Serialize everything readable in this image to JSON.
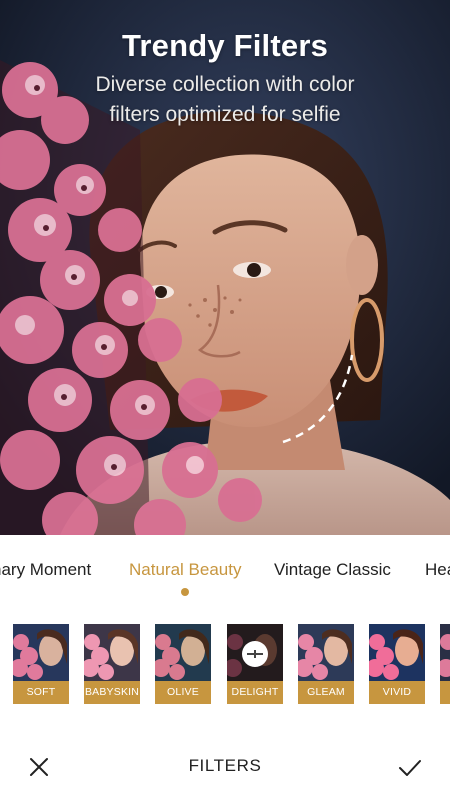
{
  "banner": {
    "title": "Trendy Filters",
    "subtitle_line1": "Diverse collection with color",
    "subtitle_line2": "filters optimized for selfie"
  },
  "categories": {
    "items": [
      {
        "label": "nary Moment"
      },
      {
        "label": "Natural Beauty",
        "active": true
      },
      {
        "label": "Vintage Classic"
      },
      {
        "label": "Hea"
      }
    ],
    "accent_color": "#c7963f"
  },
  "filters": {
    "items": [
      {
        "label": "SOFT"
      },
      {
        "label": "BABYSKIN"
      },
      {
        "label": "OLIVE"
      },
      {
        "label": "DELIGHT",
        "selected": true
      },
      {
        "label": "GLEAM"
      },
      {
        "label": "VIVID"
      }
    ],
    "label_color": "#c7963f"
  },
  "bottom_bar": {
    "title": "FILTERS",
    "close_icon": "close-icon",
    "confirm_icon": "check-icon"
  }
}
